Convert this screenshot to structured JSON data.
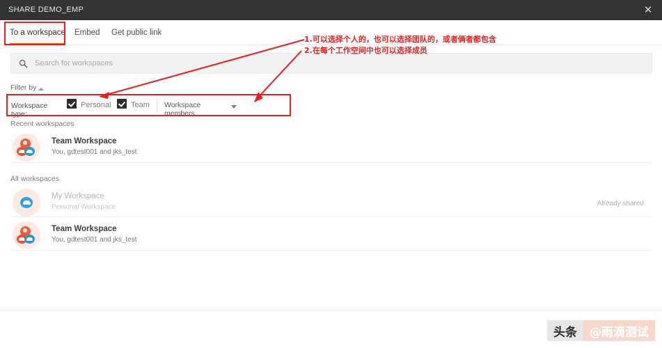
{
  "window": {
    "title": "SHARE DEMO_EMP",
    "close_icon": "close-icon",
    "close_glyph": "✕"
  },
  "tabs": [
    {
      "label": "To a workspace",
      "active": true
    },
    {
      "label": "Embed",
      "active": false
    },
    {
      "label": "Get public link",
      "active": false
    }
  ],
  "search": {
    "placeholder": "Search for workspaces",
    "value": "",
    "icon": "search-icon"
  },
  "filter": {
    "toggle_label": "Filter by",
    "toggle_icon": "caret-up-icon",
    "type_label": "Workspace type:",
    "checkboxes": [
      {
        "label": "Personal",
        "checked": true
      },
      {
        "label": "Team",
        "checked": true
      }
    ],
    "members_select": {
      "value": "Workspace members",
      "icon": "chevron-down-icon"
    }
  },
  "sections": {
    "recent_title": "Recent workspaces",
    "all_title": "All workspaces"
  },
  "recent_workspaces": [
    {
      "name": "Team Workspace",
      "subtitle": "You, gdtest001 and jks_test",
      "avatar": "team-workspace-avatar",
      "status": ""
    }
  ],
  "all_workspaces": [
    {
      "name": "My Workspace",
      "subtitle": "Personal Workspace",
      "avatar": "personal-workspace-avatar",
      "status": "Already shared"
    },
    {
      "name": "Team Workspace",
      "subtitle": "You, gdtest001 and jks_test",
      "avatar": "team-workspace-avatar",
      "status": ""
    }
  ],
  "annotations": {
    "line1": "1.可以选择个人的，也可以选择团队的，或者俩者都包含",
    "line2": "2.在每个工作空间中也可以选择成员",
    "color": "#ee1c1c"
  },
  "watermark": {
    "left": "头条",
    "right": "@雨滴测试"
  },
  "colors": {
    "accent": "#f4681a",
    "titlebar": "#333333",
    "annotation": "#ee1c1c",
    "avatar_bg": "#fdeae2",
    "avatar_red": "#f25a3c",
    "avatar_blue": "#2196d8"
  }
}
